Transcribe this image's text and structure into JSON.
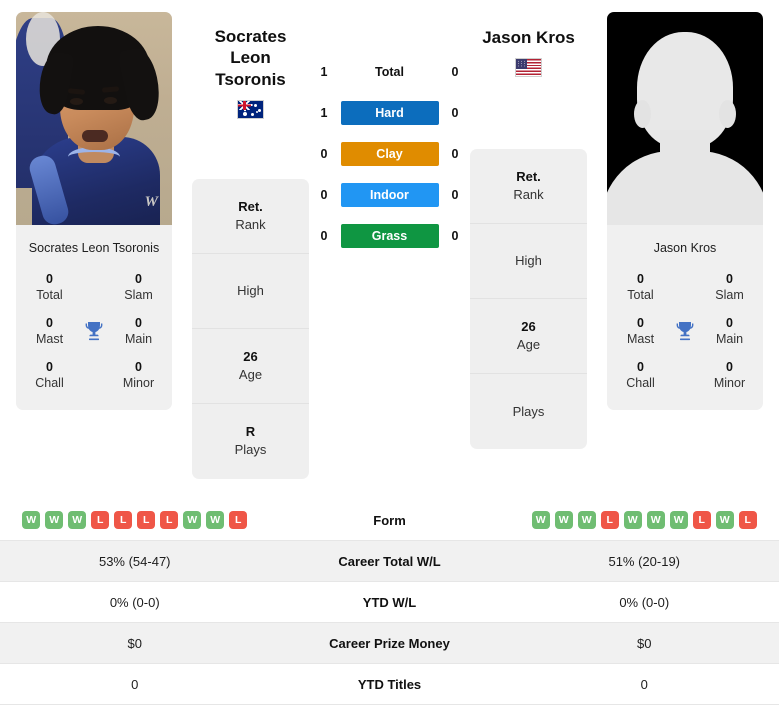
{
  "players": {
    "left": {
      "name": "Socrates Leon Tsoronis",
      "name_line1": "Socrates Leon",
      "name_line2": "Tsoronis",
      "card_name": "Socrates Leon Tsoronis",
      "flag": "australia-flag",
      "photo_logo": "W",
      "titles": [
        {
          "value": "0",
          "label": "Total"
        },
        {
          "value": "0",
          "label": "Slam"
        },
        {
          "value": "0",
          "label": "Mast"
        },
        {
          "value": "0",
          "label": "Main"
        },
        {
          "value": "0",
          "label": "Chall"
        },
        {
          "value": "0",
          "label": "Minor"
        }
      ],
      "info": [
        {
          "value": "Ret.",
          "label": "Rank"
        },
        {
          "value": "",
          "label": "High"
        },
        {
          "value": "26",
          "label": "Age"
        },
        {
          "value": "R",
          "label": "Plays"
        }
      ],
      "form": [
        "W",
        "W",
        "W",
        "L",
        "L",
        "L",
        "L",
        "W",
        "W",
        "L"
      ],
      "career_total_wl": "53% (54-47)",
      "ytd_wl": "0% (0-0)",
      "career_prize_money": "$0",
      "ytd_titles": "0"
    },
    "right": {
      "name": "Jason Kros",
      "name_line1": "Jason Kros",
      "card_name": "Jason Kros",
      "flag": "usa-flag",
      "titles": [
        {
          "value": "0",
          "label": "Total"
        },
        {
          "value": "0",
          "label": "Slam"
        },
        {
          "value": "0",
          "label": "Mast"
        },
        {
          "value": "0",
          "label": "Main"
        },
        {
          "value": "0",
          "label": "Chall"
        },
        {
          "value": "0",
          "label": "Minor"
        }
      ],
      "info": [
        {
          "value": "Ret.",
          "label": "Rank"
        },
        {
          "value": "",
          "label": "High"
        },
        {
          "value": "26",
          "label": "Age"
        },
        {
          "value": "",
          "label": "Plays"
        }
      ],
      "form": [
        "W",
        "W",
        "W",
        "L",
        "W",
        "W",
        "W",
        "L",
        "W",
        "L"
      ],
      "career_total_wl": "51% (20-19)",
      "ytd_wl": "0% (0-0)",
      "career_prize_money": "$0",
      "ytd_titles": "0"
    }
  },
  "surfaces": [
    {
      "label": "Total",
      "left": "1",
      "right": "0",
      "color": "none"
    },
    {
      "label": "Hard",
      "left": "1",
      "right": "0",
      "color": "#0c6dbd"
    },
    {
      "label": "Clay",
      "left": "0",
      "right": "0",
      "color": "#e08c00"
    },
    {
      "label": "Indoor",
      "left": "0",
      "right": "0",
      "color": "#2196f3"
    },
    {
      "label": "Grass",
      "left": "0",
      "right": "0",
      "color": "#0f9642"
    }
  ],
  "stat_rows": [
    {
      "key": "form",
      "label": "Form"
    },
    {
      "key": "career_total_wl",
      "label": "Career Total W/L"
    },
    {
      "key": "ytd_wl",
      "label": "YTD W/L"
    },
    {
      "key": "career_prize_money",
      "label": "Career Prize Money"
    },
    {
      "key": "ytd_titles",
      "label": "YTD Titles"
    }
  ],
  "colors": {
    "win_badge": "#6fbd72",
    "loss_badge": "#ef5647",
    "trophy": "#4472c4",
    "panel": "#efefef"
  }
}
